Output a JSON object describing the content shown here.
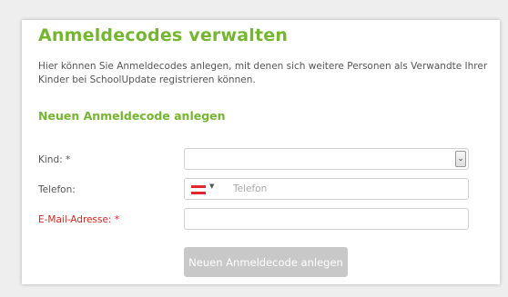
{
  "page": {
    "title": "Anmeldecodes verwalten",
    "intro": "Hier können Sie Anmeldecodes anlegen, mit denen sich weitere Personen als Verwandte Ihrer Kinder bei SchoolUpdate registrieren können.",
    "section_title": "Neuen Anmeldecode anlegen"
  },
  "form": {
    "child_label": "Kind: *",
    "child_value": "",
    "phone_label": "Telefon:",
    "phone_placeholder": "Telefon",
    "phone_country_icon": "austria-flag-icon",
    "email_label": "E-Mail-Adresse: *",
    "email_value": "",
    "submit_label": "Neuen Anmeldecode anlegen"
  },
  "colors": {
    "accent": "#74b72e",
    "required_label": "#d9231d",
    "button_disabled": "#c8c8c8"
  }
}
